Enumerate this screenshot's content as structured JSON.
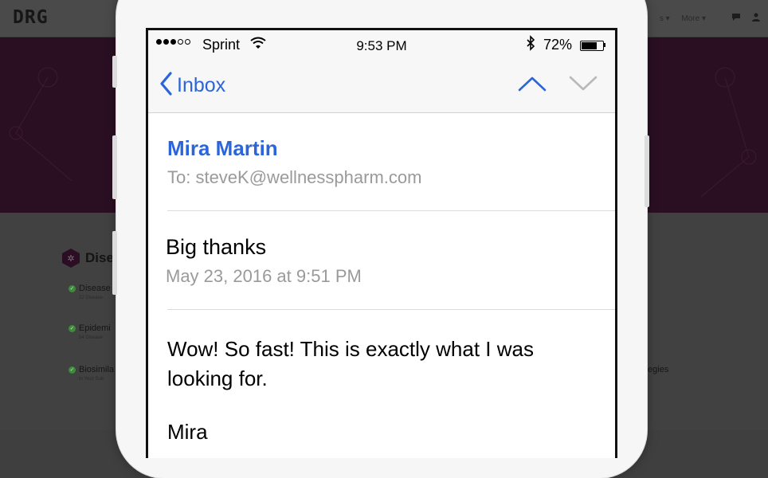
{
  "website": {
    "logo": "DRG",
    "nav": [
      "s ▾",
      "More ▾"
    ],
    "section_title": "Dise",
    "items": [
      {
        "label": "Disease",
        "sub": "22 Disease"
      },
      {
        "label": "Epidemi",
        "sub": "54 Disease"
      },
      {
        "label": "Biosimila",
        "sub": "In Your Sub"
      }
    ],
    "right_text": "tegies"
  },
  "status_bar": {
    "carrier": "Sprint",
    "time": "9:53 PM",
    "battery_percent_text": "72%",
    "battery_level": 0.72,
    "signal_bars_filled": 3,
    "signal_bars_total": 5
  },
  "nav": {
    "back_label": "Inbox",
    "accent_color": "#2b65d9"
  },
  "message": {
    "sender": "Mira Martin",
    "recipient": "To: steveK@wellnesspharm.com",
    "subject": "Big thanks",
    "date": "May 23, 2016 at 9:51 PM",
    "body": "Wow! So fast! This is exactly what I was looking for.",
    "signoff": "Mira"
  },
  "icons": [
    "chevron-left-icon",
    "chevron-up-icon",
    "chevron-down-icon",
    "wifi-icon",
    "bluetooth-icon",
    "battery-icon"
  ]
}
